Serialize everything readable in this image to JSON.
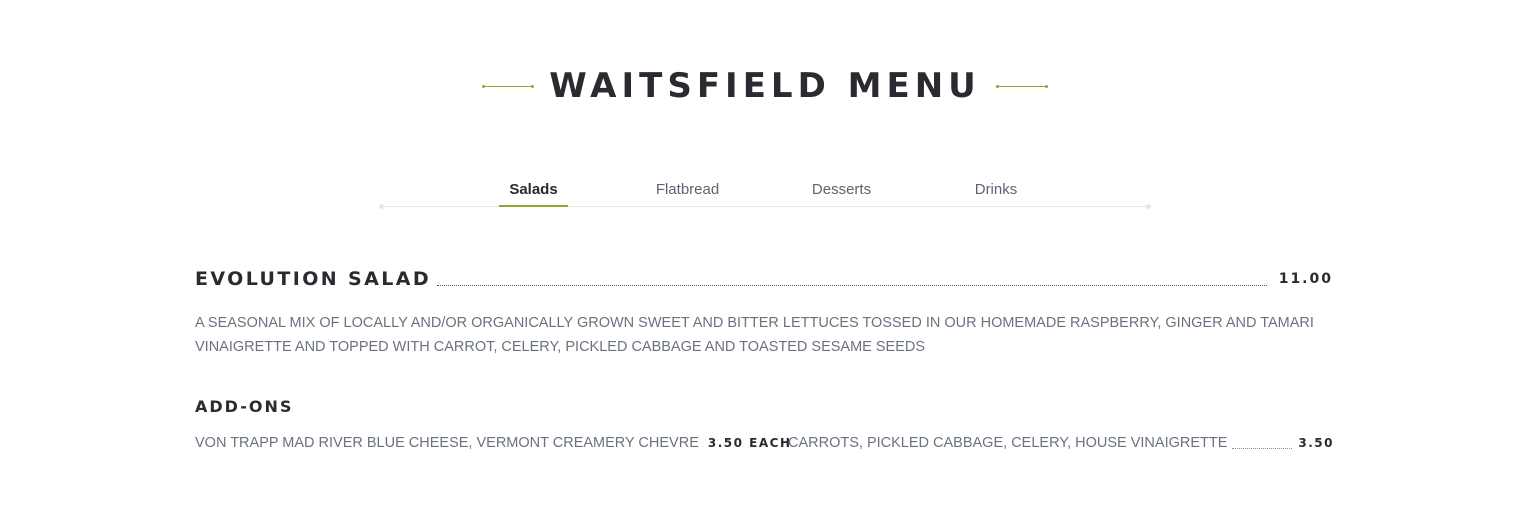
{
  "header": {
    "title": "WAITSFIELD MENU"
  },
  "tabs": [
    {
      "label": "Salads",
      "active": true
    },
    {
      "label": "Flatbread",
      "active": false
    },
    {
      "label": "Desserts",
      "active": false
    },
    {
      "label": "Drinks",
      "active": false
    }
  ],
  "menu": {
    "item": {
      "name": "EVOLUTION SALAD",
      "price": "11.00",
      "description": "A SEASONAL MIX OF LOCALLY AND/OR ORGANICALLY GROWN SWEET AND BITTER LETTUCES TOSSED IN OUR HOMEMADE RASPBERRY, GINGER AND TAMARI VINAIGRETTE AND TOPPED WITH CARROT, CELERY, PICKLED CABBAGE AND TOASTED SESAME SEEDS"
    },
    "addons": {
      "title": "ADD-ONS",
      "left": {
        "text": "VON TRAPP MAD RIVER BLUE CHEESE, VERMONT CREAMERY CHEVRE",
        "price": "3.50 EACH"
      },
      "right": {
        "text": "CARROTS, PICKLED CABBAGE, CELERY, HOUSE VINAIGRETTE",
        "price": "3.50"
      }
    }
  },
  "colors": {
    "accent": "#8aa832",
    "heading": "#2a2a30",
    "body_text": "#6a7280",
    "tab_text": "#5d6470"
  }
}
